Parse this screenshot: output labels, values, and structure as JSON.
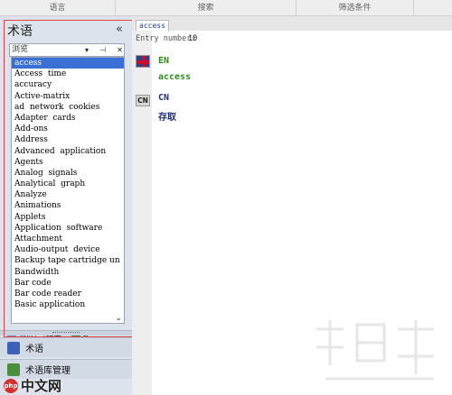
{
  "top_header": {
    "columns": [
      "语言",
      "搜索",
      "筛选条件",
      ""
    ]
  },
  "left_pane": {
    "title": "术语",
    "collapse": "«",
    "combo_value": "浏览",
    "combo_controls": {
      "dropdown": "▾",
      "pin": "⊣",
      "close": "✕"
    },
    "terms": [
      "access",
      "Access  time",
      "accuracy",
      "Active-matrix",
      "ad  network  cookies",
      "Adapter  cards",
      "Add-ons",
      "Address",
      "Advanced  application",
      "Agents",
      "Analog  signals",
      "Analytical  graph",
      "Analyze",
      "Animations",
      "Applets",
      "Application  software",
      "Attachment",
      "Audio-output  device",
      "Backup tape cartridge un",
      "Bandwidth",
      "Bar code",
      "Bar code reader",
      "Basic application"
    ],
    "selected_term": "access",
    "scroll_down": "⌄",
    "tabs": [
      "浏览",
      "结果…",
      "术…"
    ],
    "nav": [
      "术语",
      "术语库管理"
    ]
  },
  "content": {
    "doc_tab": "access",
    "entry_label": "Entry number:",
    "entry_number": "10",
    "en_label": "EN",
    "en_value": "access",
    "cn_badge": "CN",
    "cn_label": "CN",
    "cn_value": "存取"
  },
  "watermark": {
    "brand": "php",
    "site": "中文网"
  },
  "colors": {
    "selection": "#3a6fd4",
    "en_green": "#2e8b17",
    "cn_blue": "#1f2e7a",
    "highlight_outline": "#d9434a"
  },
  "icons": [
    "dropdown-arrow-icon",
    "pin-icon",
    "close-icon",
    "uk-flag-icon",
    "browse-tab-icon",
    "results-tab-icon",
    "term-tab-icon",
    "term-nav-icon",
    "termbase-nav-icon"
  ]
}
